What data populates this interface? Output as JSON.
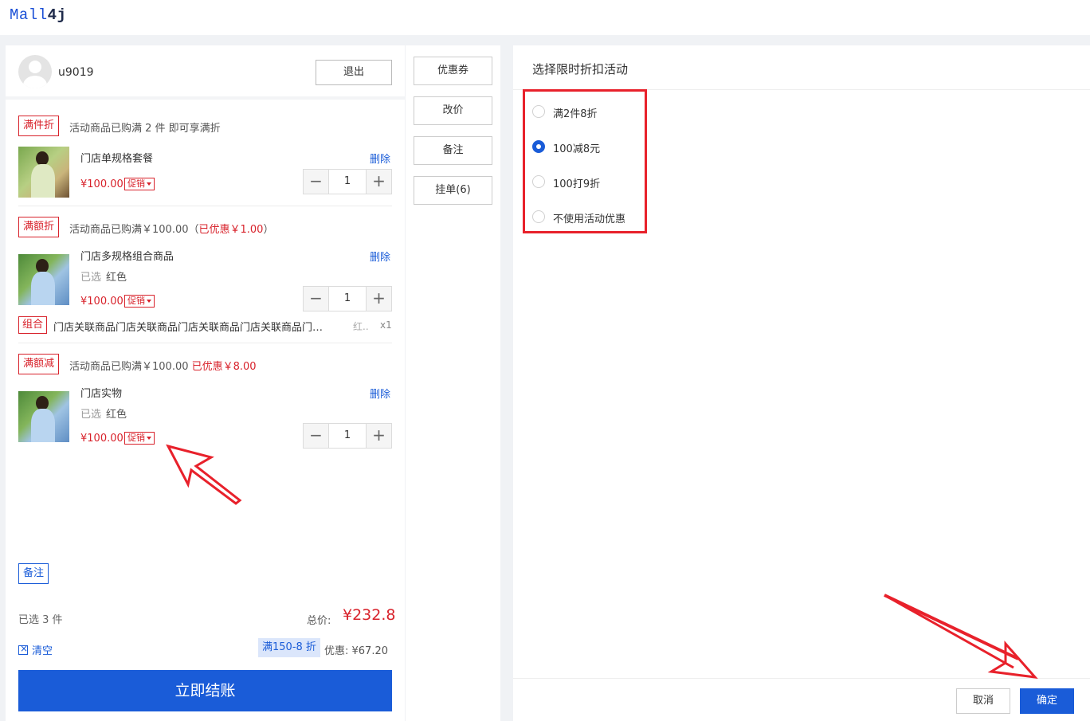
{
  "app": {
    "logo_prefix": "Mall",
    "logo_suffix": "4j"
  },
  "user": {
    "name": "u9019",
    "logout_label": "退出"
  },
  "cart": {
    "groups": [
      {
        "tag": "满件折",
        "desc": "活动商品已购满 2 件 即可享满折",
        "products": [
          {
            "name": "门店单规格套餐",
            "price": "¥100.00",
            "promo": "促销",
            "qty": "1",
            "delete": "删除"
          }
        ]
      },
      {
        "tag": "满额折",
        "desc_prefix": "活动商品已购满￥100.00（",
        "desc_highlight": "已优惠￥1.00",
        "desc_suffix": "）",
        "products": [
          {
            "name": "门店多规格组合商品",
            "spec_label": "已选",
            "spec_value": "红色",
            "price": "¥100.00",
            "promo": "促销",
            "qty": "1",
            "delete": "删除"
          }
        ],
        "combo": {
          "tag": "组合",
          "name": "门店关联商品门店关联商品门店关联商品门店关联商品门…",
          "spec": "红..",
          "qty": "x1"
        }
      },
      {
        "tag": "满额减",
        "desc_prefix": "活动商品已购满￥100.00 ",
        "desc_highlight": "已优惠￥8.00",
        "products": [
          {
            "name": "门店实物",
            "spec_label": "已选",
            "spec_value": "红色",
            "price": "¥100.00",
            "promo": "促销",
            "qty": "1",
            "delete": "删除"
          }
        ]
      }
    ],
    "note_label": "备注",
    "selected_count": "已选 3 件",
    "total_label": "总价:",
    "total_value": "¥232.8",
    "clear_label": "清空",
    "discount_badge": "满150-8 折",
    "saving": "优惠: ¥67.20",
    "checkout_label": "立即结账"
  },
  "side_actions": [
    "优惠券",
    "改价",
    "备注",
    "挂单(6)"
  ],
  "dialog": {
    "title": "选择限时折扣活动",
    "options": [
      {
        "label": "满2件8折",
        "selected": false
      },
      {
        "label": "100减8元",
        "selected": true
      },
      {
        "label": "100打9折",
        "selected": false
      },
      {
        "label": "不使用活动优惠",
        "selected": false
      }
    ],
    "cancel_label": "取消",
    "confirm_label": "确定"
  },
  "colors": {
    "accent": "#1a5cd8",
    "price_red": "#d8222b",
    "annotation_red": "#e8212b"
  }
}
